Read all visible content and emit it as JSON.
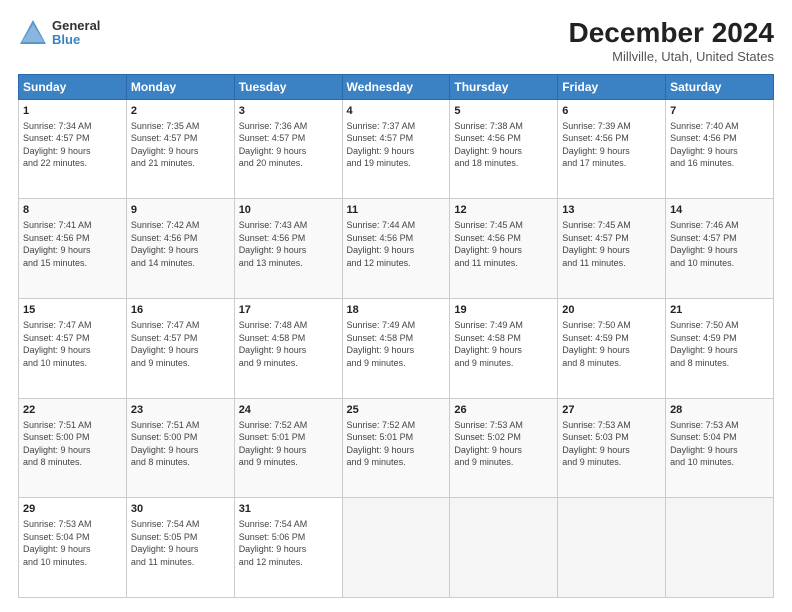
{
  "logo": {
    "general": "General",
    "blue": "Blue"
  },
  "header": {
    "month": "December 2024",
    "location": "Millville, Utah, United States"
  },
  "days_of_week": [
    "Sunday",
    "Monday",
    "Tuesday",
    "Wednesday",
    "Thursday",
    "Friday",
    "Saturday"
  ],
  "weeks": [
    [
      {
        "day": "1",
        "info": "Sunrise: 7:34 AM\nSunset: 4:57 PM\nDaylight: 9 hours\nand 22 minutes."
      },
      {
        "day": "2",
        "info": "Sunrise: 7:35 AM\nSunset: 4:57 PM\nDaylight: 9 hours\nand 21 minutes."
      },
      {
        "day": "3",
        "info": "Sunrise: 7:36 AM\nSunset: 4:57 PM\nDaylight: 9 hours\nand 20 minutes."
      },
      {
        "day": "4",
        "info": "Sunrise: 7:37 AM\nSunset: 4:57 PM\nDaylight: 9 hours\nand 19 minutes."
      },
      {
        "day": "5",
        "info": "Sunrise: 7:38 AM\nSunset: 4:56 PM\nDaylight: 9 hours\nand 18 minutes."
      },
      {
        "day": "6",
        "info": "Sunrise: 7:39 AM\nSunset: 4:56 PM\nDaylight: 9 hours\nand 17 minutes."
      },
      {
        "day": "7",
        "info": "Sunrise: 7:40 AM\nSunset: 4:56 PM\nDaylight: 9 hours\nand 16 minutes."
      }
    ],
    [
      {
        "day": "8",
        "info": "Sunrise: 7:41 AM\nSunset: 4:56 PM\nDaylight: 9 hours\nand 15 minutes."
      },
      {
        "day": "9",
        "info": "Sunrise: 7:42 AM\nSunset: 4:56 PM\nDaylight: 9 hours\nand 14 minutes."
      },
      {
        "day": "10",
        "info": "Sunrise: 7:43 AM\nSunset: 4:56 PM\nDaylight: 9 hours\nand 13 minutes."
      },
      {
        "day": "11",
        "info": "Sunrise: 7:44 AM\nSunset: 4:56 PM\nDaylight: 9 hours\nand 12 minutes."
      },
      {
        "day": "12",
        "info": "Sunrise: 7:45 AM\nSunset: 4:56 PM\nDaylight: 9 hours\nand 11 minutes."
      },
      {
        "day": "13",
        "info": "Sunrise: 7:45 AM\nSunset: 4:57 PM\nDaylight: 9 hours\nand 11 minutes."
      },
      {
        "day": "14",
        "info": "Sunrise: 7:46 AM\nSunset: 4:57 PM\nDaylight: 9 hours\nand 10 minutes."
      }
    ],
    [
      {
        "day": "15",
        "info": "Sunrise: 7:47 AM\nSunset: 4:57 PM\nDaylight: 9 hours\nand 10 minutes."
      },
      {
        "day": "16",
        "info": "Sunrise: 7:47 AM\nSunset: 4:57 PM\nDaylight: 9 hours\nand 9 minutes."
      },
      {
        "day": "17",
        "info": "Sunrise: 7:48 AM\nSunset: 4:58 PM\nDaylight: 9 hours\nand 9 minutes."
      },
      {
        "day": "18",
        "info": "Sunrise: 7:49 AM\nSunset: 4:58 PM\nDaylight: 9 hours\nand 9 minutes."
      },
      {
        "day": "19",
        "info": "Sunrise: 7:49 AM\nSunset: 4:58 PM\nDaylight: 9 hours\nand 9 minutes."
      },
      {
        "day": "20",
        "info": "Sunrise: 7:50 AM\nSunset: 4:59 PM\nDaylight: 9 hours\nand 8 minutes."
      },
      {
        "day": "21",
        "info": "Sunrise: 7:50 AM\nSunset: 4:59 PM\nDaylight: 9 hours\nand 8 minutes."
      }
    ],
    [
      {
        "day": "22",
        "info": "Sunrise: 7:51 AM\nSunset: 5:00 PM\nDaylight: 9 hours\nand 8 minutes."
      },
      {
        "day": "23",
        "info": "Sunrise: 7:51 AM\nSunset: 5:00 PM\nDaylight: 9 hours\nand 8 minutes."
      },
      {
        "day": "24",
        "info": "Sunrise: 7:52 AM\nSunset: 5:01 PM\nDaylight: 9 hours\nand 9 minutes."
      },
      {
        "day": "25",
        "info": "Sunrise: 7:52 AM\nSunset: 5:01 PM\nDaylight: 9 hours\nand 9 minutes."
      },
      {
        "day": "26",
        "info": "Sunrise: 7:53 AM\nSunset: 5:02 PM\nDaylight: 9 hours\nand 9 minutes."
      },
      {
        "day": "27",
        "info": "Sunrise: 7:53 AM\nSunset: 5:03 PM\nDaylight: 9 hours\nand 9 minutes."
      },
      {
        "day": "28",
        "info": "Sunrise: 7:53 AM\nSunset: 5:04 PM\nDaylight: 9 hours\nand 10 minutes."
      }
    ],
    [
      {
        "day": "29",
        "info": "Sunrise: 7:53 AM\nSunset: 5:04 PM\nDaylight: 9 hours\nand 10 minutes."
      },
      {
        "day": "30",
        "info": "Sunrise: 7:54 AM\nSunset: 5:05 PM\nDaylight: 9 hours\nand 11 minutes."
      },
      {
        "day": "31",
        "info": "Sunrise: 7:54 AM\nSunset: 5:06 PM\nDaylight: 9 hours\nand 12 minutes."
      },
      {
        "day": "",
        "info": ""
      },
      {
        "day": "",
        "info": ""
      },
      {
        "day": "",
        "info": ""
      },
      {
        "day": "",
        "info": ""
      }
    ]
  ]
}
